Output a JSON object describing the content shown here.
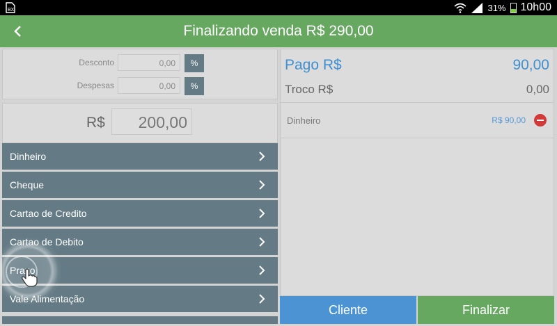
{
  "status_bar": {
    "battery_percent": "31%",
    "battery_level": 0.31,
    "time": "10h00"
  },
  "header": {
    "title": "Finalizando venda R$ 290,00",
    "back_icon": "chevron-left-icon"
  },
  "adjustments": {
    "discount_label": "Desconto",
    "discount_value": "0,00",
    "expenses_label": "Despesas",
    "expenses_value": "0,00",
    "percent_label": "%"
  },
  "amount": {
    "currency_label": "R$",
    "value": "200,00"
  },
  "payment_methods": [
    {
      "label": "Dinheiro"
    },
    {
      "label": "Cheque"
    },
    {
      "label": "Cartao de Credito"
    },
    {
      "label": "Cartao de Debito"
    },
    {
      "label": "Prazo"
    },
    {
      "label": "Vale Alimentação"
    }
  ],
  "summary": {
    "paid_label": "Pago R$",
    "paid_value": "90,00",
    "change_label": "Troco R$",
    "change_value": "0,00",
    "payments": [
      {
        "method": "Dinheiro",
        "value": "R$ 90,00"
      }
    ]
  },
  "actions": {
    "client_label": "Cliente",
    "finish_label": "Finalizar"
  },
  "colors": {
    "header_green": "#66a860",
    "method_slate": "#647b85",
    "accent_blue": "#3f8fd1",
    "remove_red": "#d23a3a"
  }
}
